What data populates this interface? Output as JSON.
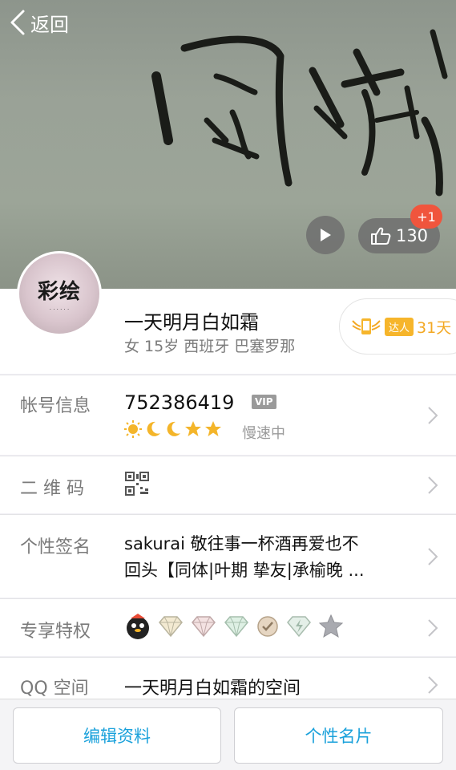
{
  "header": {
    "back_label": "返回",
    "likes": "130",
    "like_increment": "+1"
  },
  "profile": {
    "avatar_text": "彩绘",
    "nickname": "一天明月白如霜",
    "meta": "女 15岁 西班牙 巴塞罗那",
    "daren_label": "达人",
    "daren_days": "31天"
  },
  "rows": {
    "account": {
      "label": "帐号信息",
      "number": "752386419",
      "vip": "VIP",
      "speed": "慢速中"
    },
    "qr": {
      "label": "二 维 码"
    },
    "signature": {
      "label": "个性签名",
      "line1": "sakurai   敬往事一杯酒再爱也不",
      "line2": "回头【同体|叶期   挚友|承榆晚  ..."
    },
    "privileges": {
      "label": "专享特权"
    },
    "qzone": {
      "label": "QQ 空间",
      "value": "一天明月白如霜的空间"
    }
  },
  "bottom": {
    "edit_label": "编辑资料",
    "card_label": "个性名片"
  },
  "colors": {
    "accent_blue": "#1aa1db",
    "badge_red": "#f0553d",
    "daren_orange": "#f3a823"
  },
  "icons": [
    "back-chevron-icon",
    "play-icon",
    "thumbs-up-icon",
    "qr-code-icon",
    "sun-icon",
    "moon-icon",
    "star-icon",
    "chevron-right-icon"
  ]
}
